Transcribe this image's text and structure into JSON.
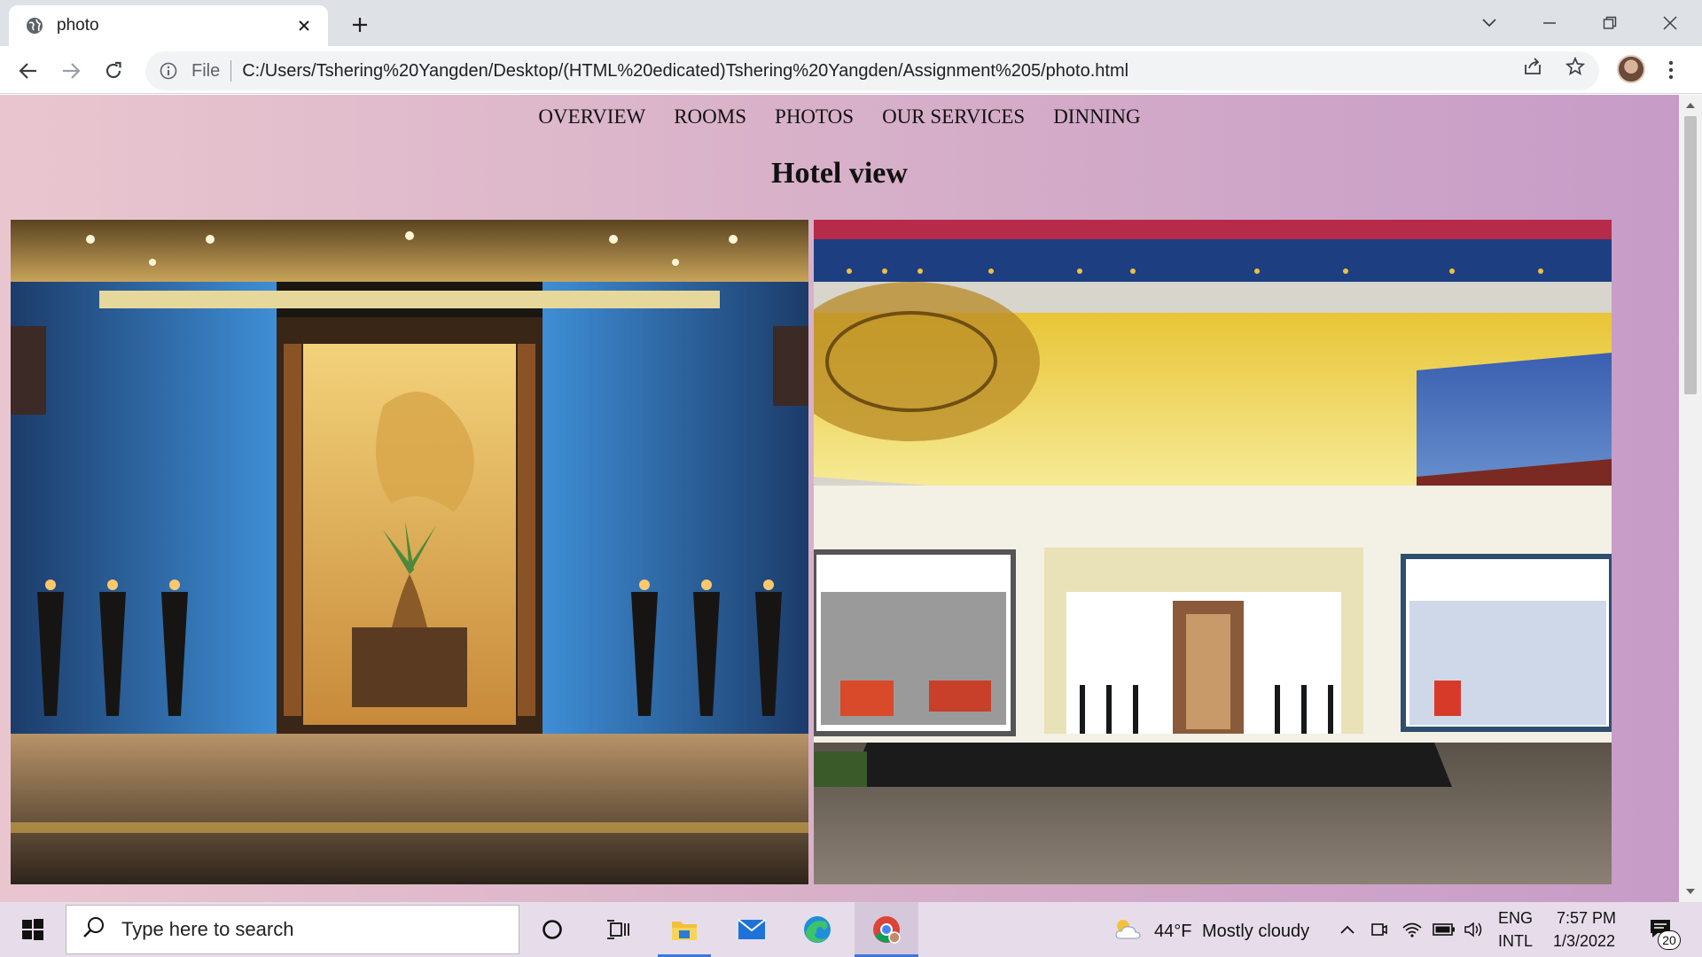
{
  "browser": {
    "tab_title": "photo",
    "address_scheme_label": "File",
    "address_url": "C:/Users/Tshering%20Yangden/Desktop/(HTML%20edicated)Tshering%20Yangden/Assignment%205/photo.html"
  },
  "page": {
    "nav": [
      "OVERVIEW",
      "ROOMS",
      "PHOTOS",
      "OUR SERVICES",
      "DINNING"
    ],
    "heading": "Hotel view",
    "background_gradient": [
      "#e9c6cf",
      "#c69bc7"
    ]
  },
  "taskbar": {
    "search_placeholder": "Type here to search",
    "weather_temp": "44°F",
    "weather_desc": "Mostly cloudy",
    "lang_top": "ENG",
    "lang_bottom": "INTL",
    "time": "7:57 PM",
    "date": "1/3/2022",
    "notification_count": "20"
  }
}
